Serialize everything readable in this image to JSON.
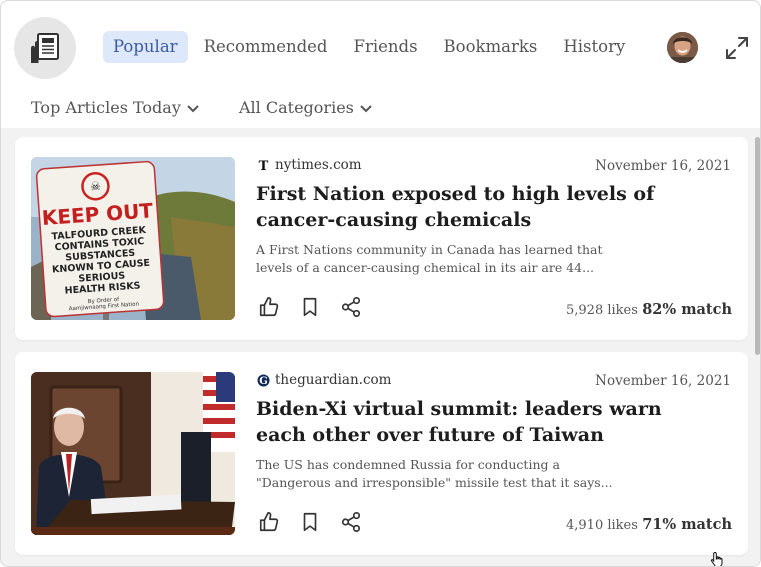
{
  "app": {
    "logo_icon": "newspaper-hand-icon"
  },
  "nav": {
    "tabs": [
      {
        "label": "Popular",
        "active": true
      },
      {
        "label": "Recommended",
        "active": false
      },
      {
        "label": "Friends",
        "active": false
      },
      {
        "label": "Bookmarks",
        "active": false
      },
      {
        "label": "History",
        "active": false
      }
    ],
    "avatar_icon": "user-avatar",
    "expand_icon": "expand-icon"
  },
  "filters": {
    "period": "Top Articles Today",
    "category": "All Categories"
  },
  "articles": [
    {
      "source": "nytimes.com",
      "date": "November 16, 2021",
      "headline": "First Nation exposed to high levels of cancer-causing chemicals",
      "summary": "A First Nations community in Canada has learned that levels of a cancer-causing chemical in its air are 44...",
      "likes": "5,928 likes",
      "match": "82% match",
      "image_sign": {
        "title": "KEEP OUT",
        "lines": [
          "TALFOURD CREEK",
          "CONTAINS TOXIC",
          "SUBSTANCES",
          "KNOWN TO CAUSE",
          "SERIOUS",
          "HEALTH RISKS"
        ],
        "footer": [
          "By Order of",
          "Aamjiwnaang First Nation"
        ]
      }
    },
    {
      "source": "theguardian.com",
      "date": "November 16, 2021",
      "headline": "Biden-Xi virtual summit: leaders warn each other over future of Taiwan",
      "summary": "The US has condemned Russia for conducting a \"Dangerous and irresponsible\" missile test that it says...",
      "likes": "4,910 likes",
      "match": "71% match"
    }
  ],
  "colors": {
    "active_tab_bg": "#dde8fb",
    "active_tab_text": "#3b5ba5",
    "feed_bg": "#f2f2f2"
  }
}
